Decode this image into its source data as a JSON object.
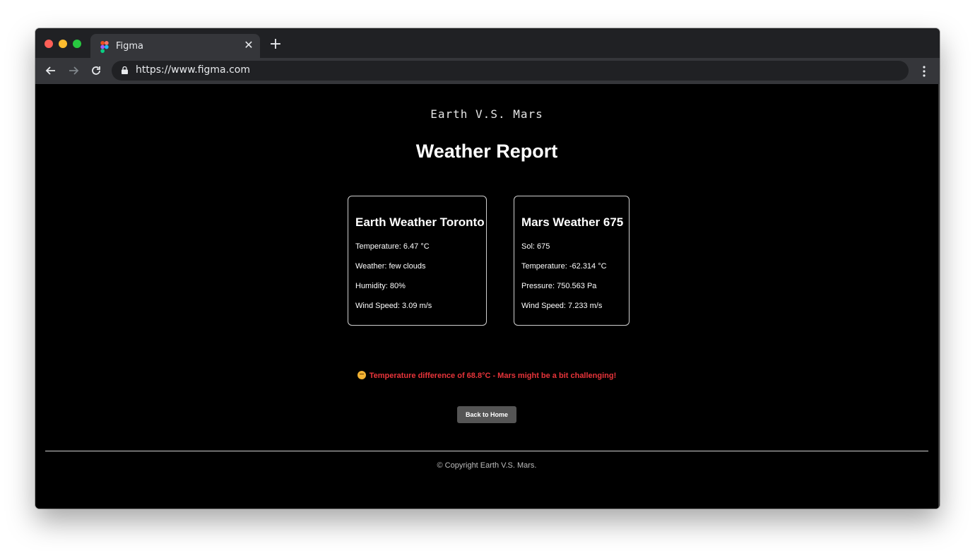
{
  "browser": {
    "tab_title": "Figma",
    "tab_close": "✕",
    "new_tab": "+",
    "url": "https://www.figma.com"
  },
  "page": {
    "brand": "Earth V.S. Mars",
    "heading": "Weather Report",
    "earth_card": {
      "title": "Earth Weather Toronto",
      "lines": [
        "Temperature: 6.47 °C",
        "Weather: few clouds",
        "Humidity: 80%",
        "Wind Speed: 3.09 m/s"
      ]
    },
    "mars_card": {
      "title": "Mars Weather 675",
      "lines": [
        "Sol: 675",
        "Temperature: -62.314 °C",
        "Pressure: 750.563 Pa",
        "Wind Speed: 7.233 m/s"
      ]
    },
    "difference_message": "Temperature difference of 68.8°C - Mars might be a bit challenging!",
    "back_button": "Back to Home",
    "copyright": "© Copyright Earth V.S. Mars."
  },
  "colors": {
    "alert": "#e8343a",
    "button": "#555555",
    "background": "#000000"
  }
}
